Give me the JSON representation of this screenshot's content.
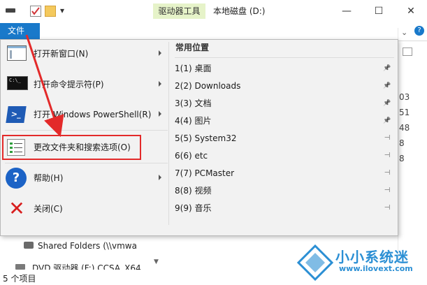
{
  "window": {
    "context_tab": "驱动器工具",
    "title": "本地磁盘 (D:)",
    "minimize": "—",
    "maximize": "☐",
    "close": "✕",
    "dropdown": "▾"
  },
  "ribbon": {
    "file_tab": "文件"
  },
  "menu": {
    "left_items": [
      {
        "label": "打开新窗口(N)",
        "icon": "new-window-icon",
        "has_arrow": true
      },
      {
        "label": "打开命令提示符(P)",
        "icon": "command-prompt-icon",
        "has_arrow": true
      },
      {
        "label": "打开 Windows PowerShell(R)",
        "icon": "powershell-icon",
        "has_arrow": true
      },
      {
        "label": "更改文件夹和搜索选项(O)",
        "icon": "folder-options-icon",
        "has_arrow": false
      },
      {
        "label": "帮助(H)",
        "icon": "help-icon",
        "has_arrow": true
      },
      {
        "label": "关闭(C)",
        "icon": "close-x-icon",
        "has_arrow": false
      }
    ],
    "recent_title": "常用位置",
    "recent_items": [
      {
        "label": "1(1)  桌面",
        "pin": "pinned"
      },
      {
        "label": "2(2)  Downloads",
        "pin": "pinned"
      },
      {
        "label": "3(3)  文档",
        "pin": "pinned"
      },
      {
        "label": "4(4)  图片",
        "pin": "pinned"
      },
      {
        "label": "5(5)  System32",
        "pin": "unpinned"
      },
      {
        "label": "6(6)  etc",
        "pin": "unpinned"
      },
      {
        "label": "7(7)  PCMaster",
        "pin": "unpinned"
      },
      {
        "label": "8(8)  视频",
        "pin": "unpinned"
      },
      {
        "label": "9(9)  音乐",
        "pin": "unpinned"
      }
    ]
  },
  "background": {
    "right_numbers": [
      "03",
      "51",
      "48",
      "8",
      "8"
    ],
    "nav_items": [
      "Shared Folders (\\\\vmwa",
      "DVD 驱动器 (F:) CCSA_X64"
    ],
    "status": "5 个项目"
  },
  "watermark": {
    "brand": "小小系统迷",
    "url": "www.ilovext.com"
  },
  "colors": {
    "accent": "#1979ca",
    "annotation": "#e32a2a",
    "context_tab": "#e6f3c9",
    "watermark": "#2b8fd4"
  }
}
